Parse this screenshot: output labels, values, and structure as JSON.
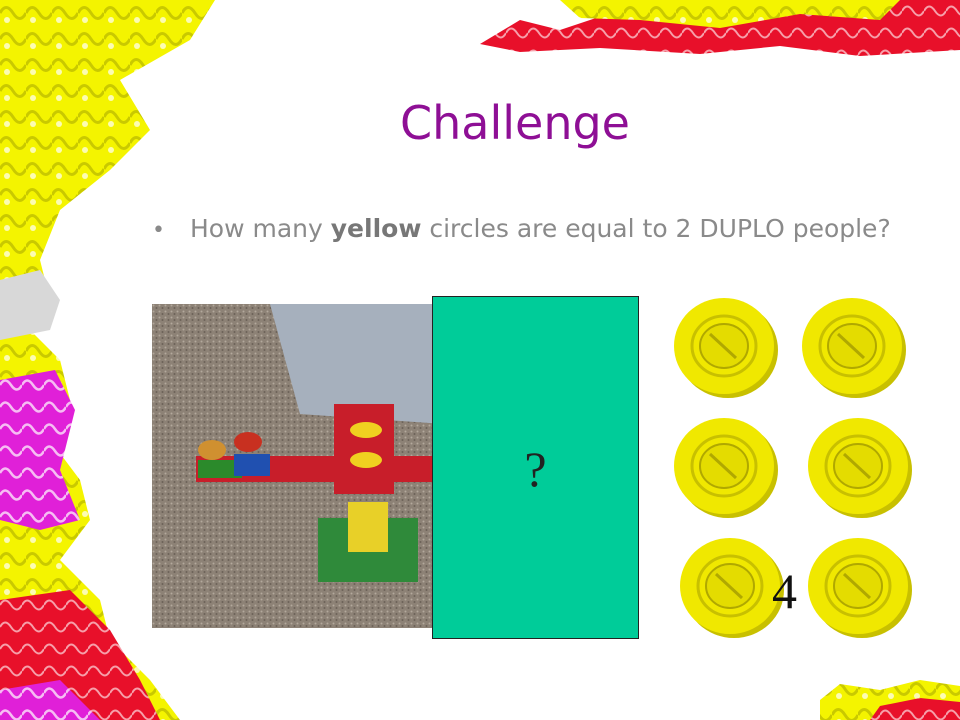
{
  "slide": {
    "title": "Challenge",
    "bullet_pre": "How many ",
    "bullet_bold": "yellow",
    "bullet_post": " circles are equal to 2 DUPLO people?",
    "cover_text": "?",
    "count_label": "4"
  },
  "colors": {
    "title": "#8e0f95",
    "cover": "#00cc99",
    "coin": "#f0e800",
    "border_yellow": "#f4f400",
    "border_red": "#e8102a",
    "border_magenta": "#e020d8"
  },
  "images": {
    "photo": "duplo-balance-scale-photo",
    "coins": "yellow-duplo-circles"
  },
  "coin_count_shown": 6
}
